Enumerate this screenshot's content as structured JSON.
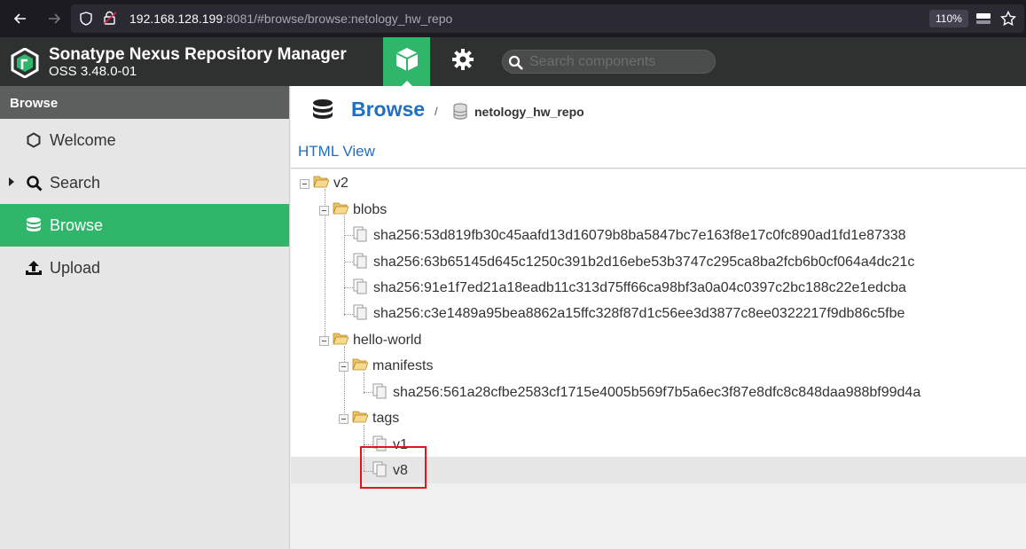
{
  "browser": {
    "url_host": "192.168.128.199",
    "url_rest": ":8081/#browse/browse:netology_hw_repo",
    "zoom": "110%"
  },
  "app": {
    "title": "Sonatype Nexus Repository Manager",
    "version": "OSS 3.48.0-01",
    "search_placeholder": "Search components"
  },
  "sidebar": {
    "header": "Browse",
    "items": [
      {
        "label": "Welcome",
        "icon": "hexagon-icon"
      },
      {
        "label": "Search",
        "icon": "search-icon"
      },
      {
        "label": "Browse",
        "icon": "database-icon",
        "active": true
      },
      {
        "label": "Upload",
        "icon": "upload-icon"
      }
    ]
  },
  "main": {
    "breadcrumb_root": "Browse",
    "breadcrumb_sep": "/",
    "breadcrumb_repo": "netology_hw_repo",
    "html_view": "HTML View"
  },
  "tree": {
    "v2": "v2",
    "blobs": "blobs",
    "blob_items": [
      "sha256:53d819fb30c45aafd13d16079b8ba5847bc7e163f8e17c0fc890ad1fd1e87338",
      "sha256:63b65145d645c1250c391b2d16ebe53b3747c295ca8ba2fcb6b0cf064a4dc21c",
      "sha256:91e1f7ed21a18eadb11c313d75ff66ca98bf3a0a04c0397c2bc188c22e1edcba",
      "sha256:c3e1489a95bea8862a15ffc328f87d1c56ee3d3877c8ee0322217f9db86c5fbe"
    ],
    "hello_world": "hello-world",
    "manifests": "manifests",
    "manifest_item": "sha256:561a28cfbe2583cf1715e4005b569f7b5a6ec3f87e8dfc8c848daa988bf99d4a",
    "tags": "tags",
    "tag_items": [
      "v1",
      "v8"
    ],
    "selected": "v8"
  },
  "colors": {
    "accent_green": "#2fb66b",
    "link_blue": "#1f6fc2",
    "highlight_red": "#e2141e"
  }
}
